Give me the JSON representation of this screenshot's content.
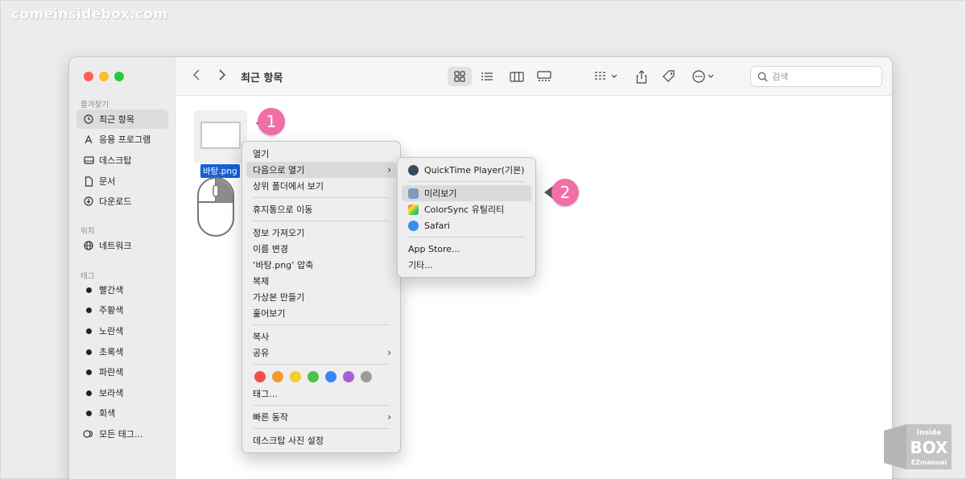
{
  "watermark": "comeinsidebox.com",
  "window": {
    "title": "최근 항목",
    "search_placeholder": "검색"
  },
  "sidebar": {
    "favorites_heading": "즐겨찾기",
    "favorites": [
      {
        "label": "최근 항목",
        "icon": "clock-icon",
        "active": true
      },
      {
        "label": "응용 프로그램",
        "icon": "applications-icon",
        "active": false
      },
      {
        "label": "데스크탑",
        "icon": "desktop-icon",
        "active": false
      },
      {
        "label": "문서",
        "icon": "document-icon",
        "active": false
      },
      {
        "label": "다운로드",
        "icon": "download-icon",
        "active": false
      }
    ],
    "locations_heading": "위치",
    "locations": [
      {
        "label": "네트워크",
        "icon": "network-icon"
      }
    ],
    "tags_heading": "태그",
    "tags": [
      {
        "label": "빨간색"
      },
      {
        "label": "주황색"
      },
      {
        "label": "노란색"
      },
      {
        "label": "초록색"
      },
      {
        "label": "파란색"
      },
      {
        "label": "보라색"
      },
      {
        "label": "회색"
      },
      {
        "label": "모든 태그..."
      }
    ]
  },
  "file": {
    "name": "바탕.png"
  },
  "badges": {
    "one": "1",
    "two": "2"
  },
  "context_menu": {
    "groups": [
      [
        "열기",
        "다음으로 열기",
        "상위 폴더에서 보기"
      ],
      [
        "휴지통으로 이동"
      ],
      [
        "정보 가져오기",
        "이름 변경",
        "‘바탕.png’ 압축",
        "복제",
        "가상본 만들기",
        "훑어보기"
      ],
      [
        "복사",
        "공유"
      ],
      [
        "태그..."
      ],
      [
        "빠른 동작"
      ],
      [
        "데스크탑 사진 설정"
      ]
    ],
    "tag_colors": [
      "#f0504a",
      "#f59a2f",
      "#f4cc33",
      "#4cc24a",
      "#3a86f5",
      "#a65fd6",
      "#9b9b9b"
    ]
  },
  "open_with_menu": {
    "default_app": "QuickTime Player",
    "default_suffix": "(기본)",
    "apps": [
      "미리보기",
      "ColorSync 유틸리티",
      "Safari"
    ],
    "app_store": "App Store...",
    "other": "기타..."
  },
  "logo": {
    "top": "inside",
    "main": "BOX",
    "bottom": "EZmanual"
  },
  "colors": {
    "badge": "#f06fa6",
    "selection": "#1660d6",
    "close": "#ff5f57",
    "minimize": "#febc2e",
    "zoom": "#28c840"
  }
}
